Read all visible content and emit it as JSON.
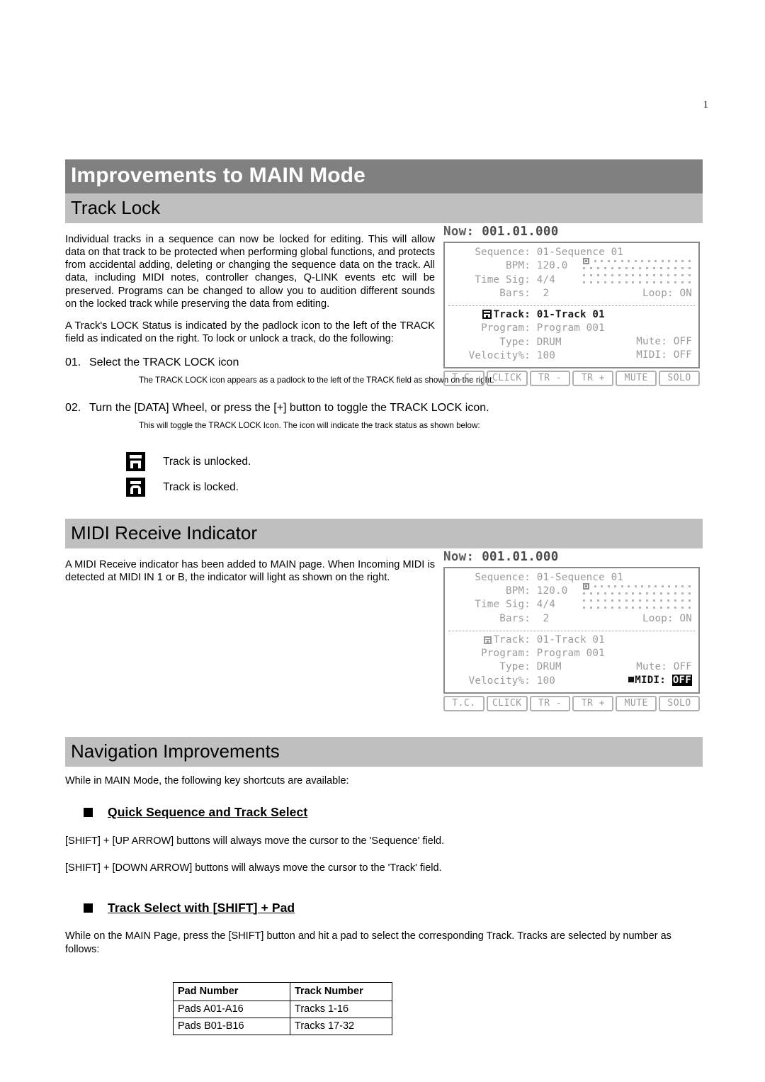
{
  "page": {
    "number": "1"
  },
  "title_bar": {
    "text": "Improvements to MAIN Mode"
  },
  "sections": {
    "track_lock": {
      "heading": "Track Lock",
      "para1": "Individual tracks in a sequence can now be locked for editing.  This will allow data on that track to be protected when performing global functions, and protects from accidental adding, deleting or changing the sequence data on the track.   All data, including MIDI notes, controller changes, Q-LINK events etc will be preserved.   Programs can be changed to allow you to audition different sounds on the locked track while preserving the data from editing.",
      "para2": "A Track's LOCK Status is indicated by the padlock icon to the left of the TRACK field as indicated on the right.   To lock or unlock a track, do the following:",
      "step1_num": "01.",
      "step1_text": "Select the TRACK LOCK icon",
      "step1_note": "The TRACK LOCK icon appears as a padlock to the left of the TRACK field as shown on the right.",
      "step2_num": "02.",
      "step2_text": "Turn the [DATA] Wheel, or press the [+] button to toggle the TRACK LOCK icon.",
      "step2_note": "This will toggle the TRACK LOCK Icon.   The icon will indicate the track status as shown below:",
      "legend_unlocked": "Track is unlocked.",
      "legend_locked": "Track is locked."
    },
    "midi_receive": {
      "heading": "MIDI Receive Indicator",
      "para1": "A MIDI Receive indicator has been added to MAIN page.   When Incoming MIDI is detected at MIDI IN 1 or B, the indicator will light as shown on the right."
    },
    "navigation": {
      "heading": "Navigation Improvements",
      "intro": "While in MAIN Mode, the following key shortcuts are available:",
      "sub1_heading": "Quick Sequence and Track Select",
      "sub1_line1": "[SHIFT] + [UP ARROW] buttons will always move the cursor to the 'Sequence' field.",
      "sub1_line2": "[SHIFT] + [DOWN ARROW] buttons will always move the cursor to the 'Track' field.",
      "sub2_heading": "Track Select with [SHIFT] + Pad",
      "sub2_para": "While on the MAIN Page, press the [SHIFT] button and hit a pad to select the corresponding Track.  Tracks are selected by number as follows:",
      "table": {
        "headers": [
          "Pad Number",
          "Track Number"
        ],
        "rows": [
          [
            "Pads A01-A16",
            "Tracks 1-16"
          ],
          [
            "Pads B01-B16",
            "Tracks 17-32"
          ]
        ]
      }
    }
  },
  "lcd1": {
    "now_label": "Now:",
    "now_value": "001.01.000",
    "sequence_label": "Sequence:",
    "sequence_value": "01-Sequence 01",
    "bpm_label": "BPM:",
    "bpm_value": "120.0",
    "timesig_label": "Time Sig:",
    "timesig_value": "4/4",
    "bars_label": "Bars:",
    "bars_value": "2",
    "loop_label": "Loop:",
    "loop_value": "ON",
    "track_label": "Track:",
    "track_value": "01-Track 01",
    "program_label": "Program:",
    "program_value": "Program 001",
    "type_label": "Type:",
    "type_value": "DRUM",
    "velocity_label": "Velocity%:",
    "velocity_value": "100",
    "mute_label": "Mute:",
    "mute_value": "OFF",
    "midi_label": "MIDI:",
    "midi_value": "OFF",
    "softbuttons": [
      "T.C.",
      "CLICK",
      "TR -",
      "TR +",
      "MUTE",
      "SOLO"
    ]
  },
  "lcd2": {
    "now_label": "Now:",
    "now_value": "001.01.000",
    "sequence_label": "Sequence:",
    "sequence_value": "01-Sequence 01",
    "bpm_label": "BPM:",
    "bpm_value": "120.0",
    "timesig_label": "Time Sig:",
    "timesig_value": "4/4",
    "bars_label": "Bars:",
    "bars_value": "2",
    "loop_label": "Loop:",
    "loop_value": "ON",
    "track_label": "Track:",
    "track_value": "01-Track 01",
    "program_label": "Program:",
    "program_value": "Program 001",
    "type_label": "Type:",
    "type_value": "DRUM",
    "velocity_label": "Velocity%:",
    "velocity_value": "100",
    "mute_label": "Mute:",
    "mute_value": "OFF",
    "midi_label": "MIDI:",
    "midi_value": "OFF",
    "softbuttons": [
      "T.C.",
      "CLICK",
      "TR -",
      "TR +",
      "MUTE",
      "SOLO"
    ]
  },
  "colors": {
    "title_bar_bg": "#808080",
    "section_bar_bg": "#bfbfbf",
    "lcd_text": "#9a9a9a",
    "lcd_border": "#8a8a8a"
  }
}
